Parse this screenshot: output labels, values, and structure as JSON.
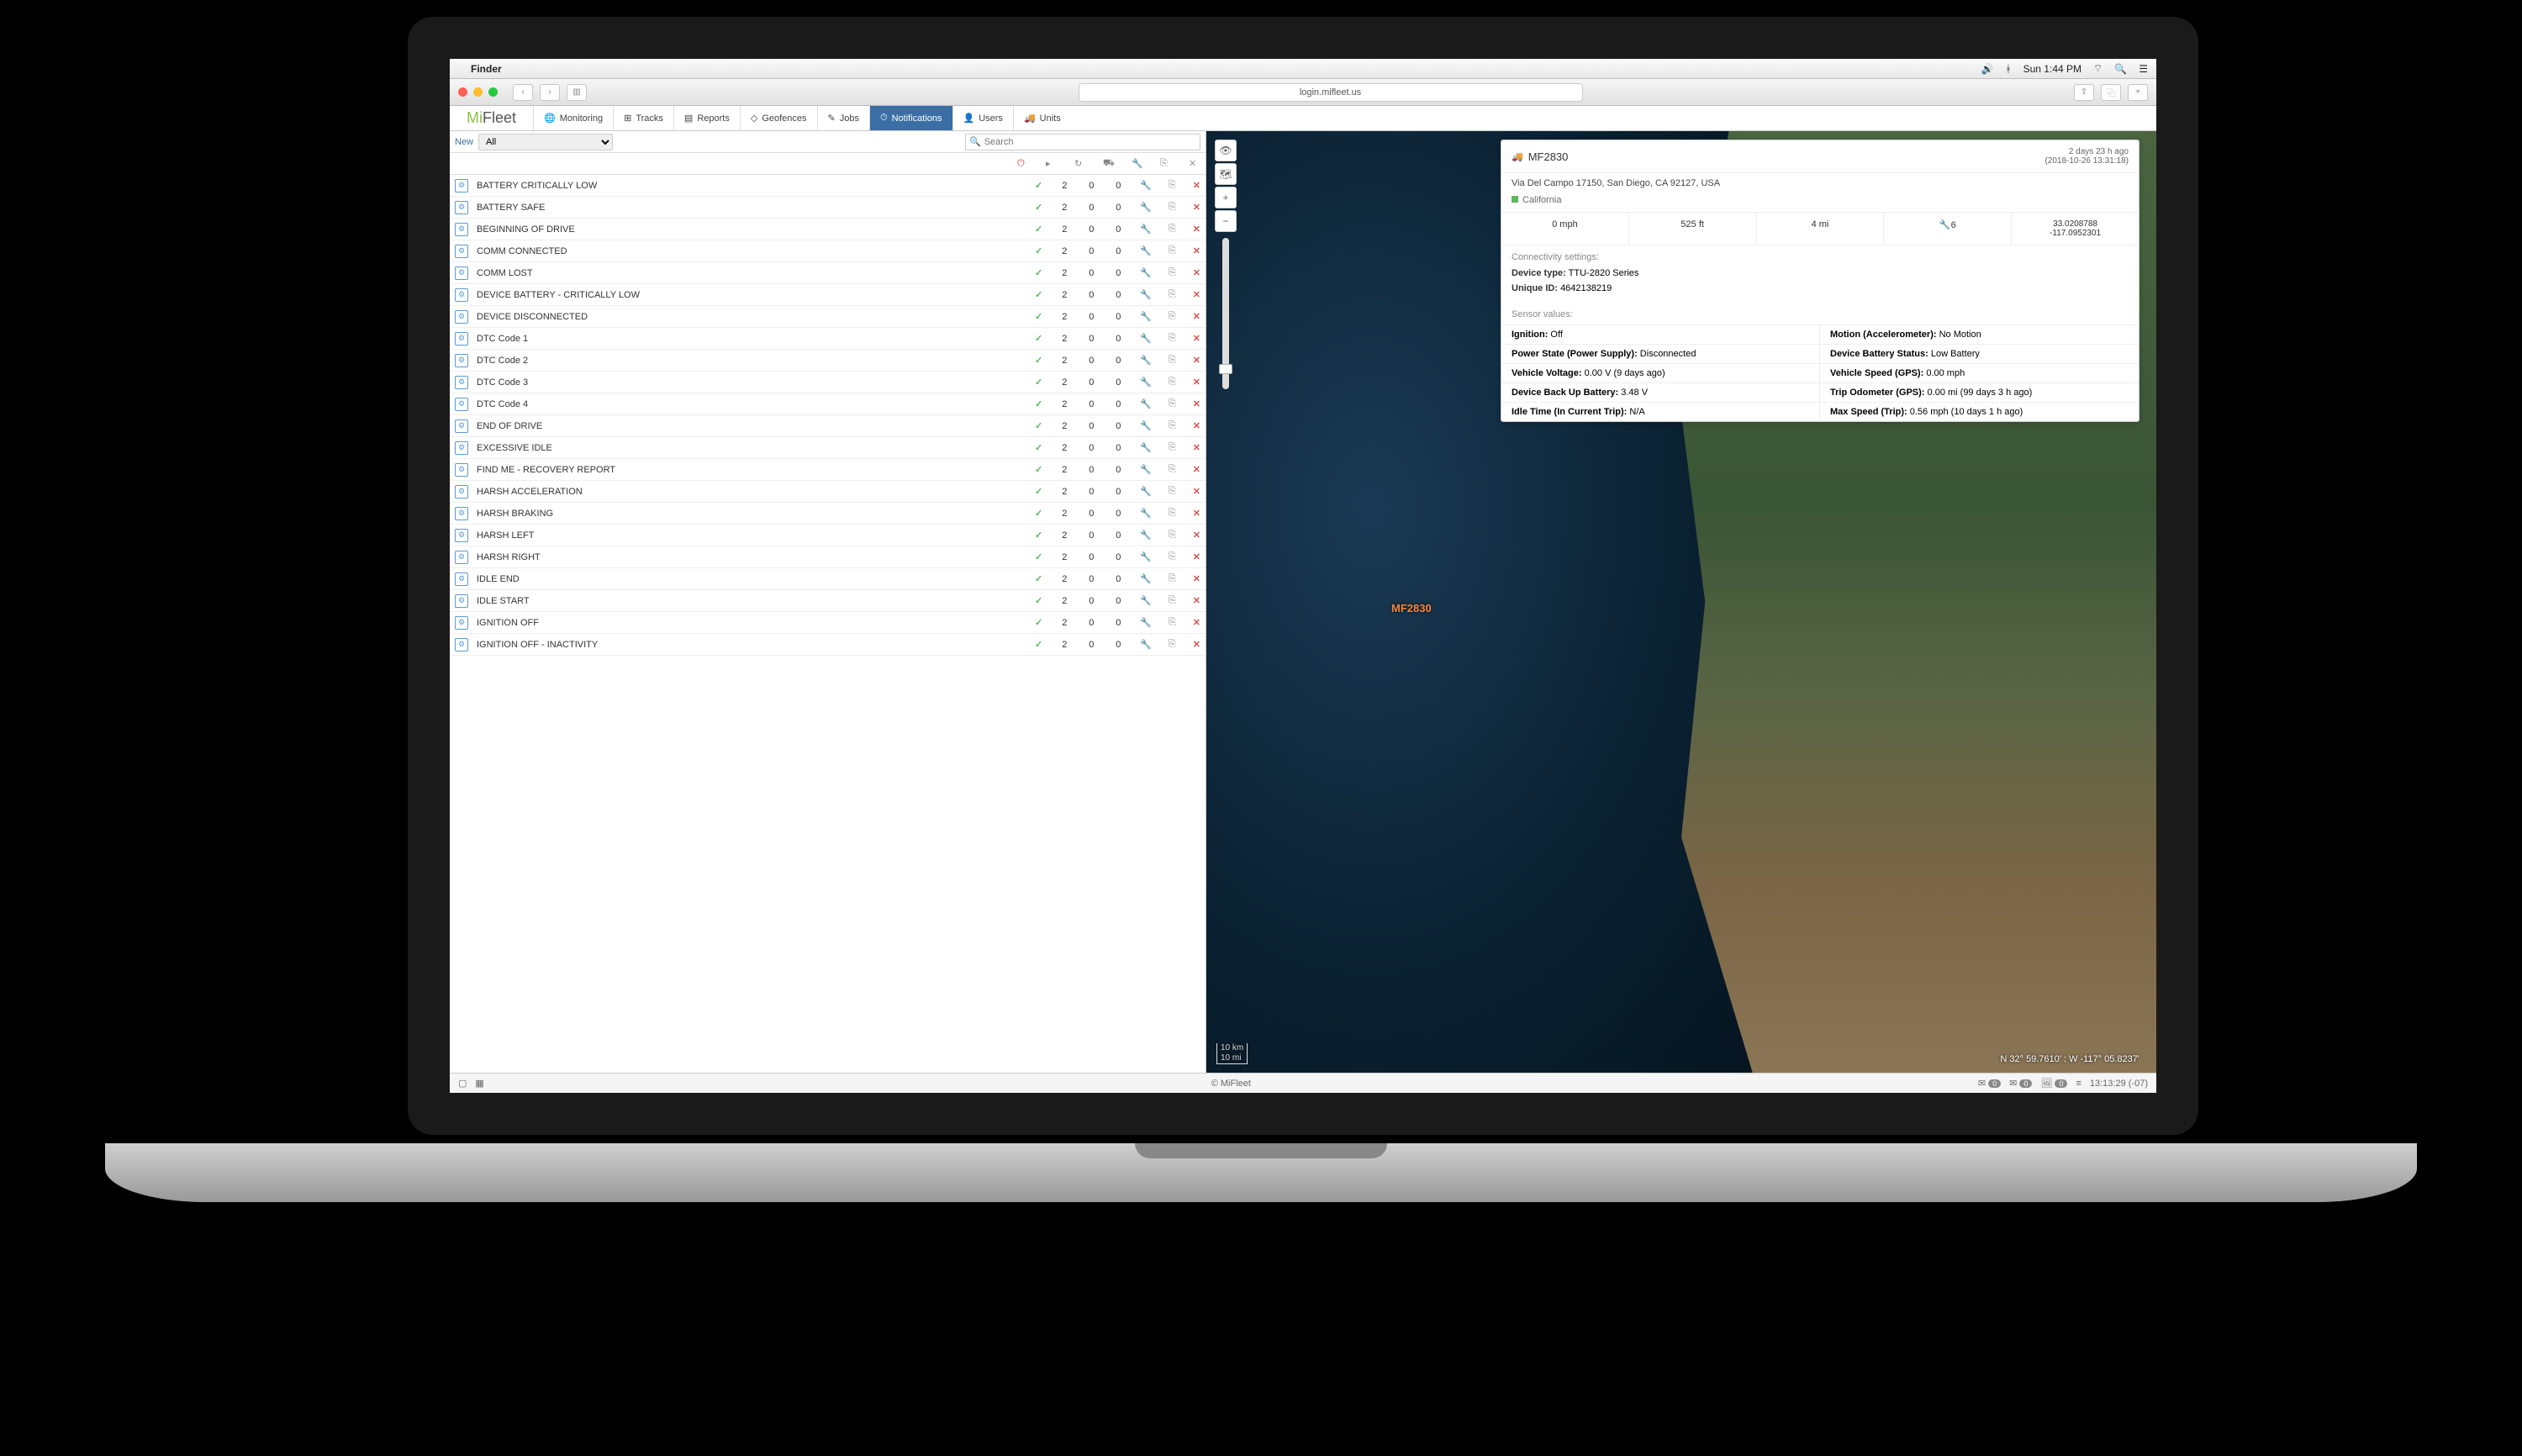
{
  "menubar": {
    "app": "Finder",
    "clock": "Sun 1:44 PM"
  },
  "browser": {
    "url": "login.mifleet.us"
  },
  "logo": {
    "mi": "Mi",
    "fleet": "Fleet"
  },
  "tabs": {
    "monitoring": "Monitoring",
    "tracks": "Tracks",
    "reports": "Reports",
    "geofences": "Geofences",
    "jobs": "Jobs",
    "notifications": "Notifications",
    "users": "Users",
    "units": "Units"
  },
  "filter": {
    "new": "New",
    "all": "All",
    "search_placeholder": "Search"
  },
  "notifications": [
    {
      "name": "BATTERY CRITICALLY LOW",
      "c1": "2",
      "c2": "0",
      "c3": "0"
    },
    {
      "name": "BATTERY SAFE",
      "c1": "2",
      "c2": "0",
      "c3": "0"
    },
    {
      "name": "BEGINNING OF DRIVE",
      "c1": "2",
      "c2": "0",
      "c3": "0"
    },
    {
      "name": "COMM CONNECTED",
      "c1": "2",
      "c2": "0",
      "c3": "0"
    },
    {
      "name": "COMM LOST",
      "c1": "2",
      "c2": "0",
      "c3": "0"
    },
    {
      "name": "DEVICE BATTERY - CRITICALLY LOW",
      "c1": "2",
      "c2": "0",
      "c3": "0"
    },
    {
      "name": "DEVICE DISCONNECTED",
      "c1": "2",
      "c2": "0",
      "c3": "0"
    },
    {
      "name": "DTC Code 1",
      "c1": "2",
      "c2": "0",
      "c3": "0"
    },
    {
      "name": "DTC Code 2",
      "c1": "2",
      "c2": "0",
      "c3": "0"
    },
    {
      "name": "DTC Code 3",
      "c1": "2",
      "c2": "0",
      "c3": "0"
    },
    {
      "name": "DTC Code 4",
      "c1": "2",
      "c2": "0",
      "c3": "0"
    },
    {
      "name": "END OF DRIVE",
      "c1": "2",
      "c2": "0",
      "c3": "0"
    },
    {
      "name": "EXCESSIVE IDLE",
      "c1": "2",
      "c2": "0",
      "c3": "0"
    },
    {
      "name": "FIND ME - RECOVERY REPORT",
      "c1": "2",
      "c2": "0",
      "c3": "0"
    },
    {
      "name": "HARSH ACCELERATION",
      "c1": "2",
      "c2": "0",
      "c3": "0"
    },
    {
      "name": "HARSH BRAKING",
      "c1": "2",
      "c2": "0",
      "c3": "0"
    },
    {
      "name": "HARSH LEFT",
      "c1": "2",
      "c2": "0",
      "c3": "0"
    },
    {
      "name": "HARSH RIGHT",
      "c1": "2",
      "c2": "0",
      "c3": "0"
    },
    {
      "name": "IDLE END",
      "c1": "2",
      "c2": "0",
      "c3": "0"
    },
    {
      "name": "IDLE START",
      "c1": "2",
      "c2": "0",
      "c3": "0"
    },
    {
      "name": "IGNITION OFF",
      "c1": "2",
      "c2": "0",
      "c3": "0"
    },
    {
      "name": "IGNITION OFF - INACTIVITY",
      "c1": "2",
      "c2": "0",
      "c3": "0"
    }
  ],
  "popup": {
    "name": "MF2830",
    "ago": "2 days 23 h ago",
    "timestamp": "(2018-10-26 13:31:18)",
    "address": "Via Del Campo 17150, San Diego, CA 92127, USA",
    "geofence": "California",
    "stats": {
      "speed": "0 mph",
      "altitude": "525 ft",
      "distance": "4 mi",
      "sat": "6",
      "lat": "33.0208788",
      "lon": "-117.0952301"
    },
    "conn": {
      "title": "Connectivity settings:",
      "device_type_l": "Device type:",
      "device_type_v": "TTU-2820 Series",
      "unique_id_l": "Unique ID:",
      "unique_id_v": "4642138219"
    },
    "sensors_title": "Sensor values:",
    "sensors": [
      {
        "l": "Ignition:",
        "v": "Off"
      },
      {
        "l": "Motion (Accelerometer):",
        "v": "No Motion"
      },
      {
        "l": "Power State (Power Supply):",
        "v": "Disconnected"
      },
      {
        "l": "Device Battery Status:",
        "v": "Low Battery"
      },
      {
        "l": "Vehicle Voltage:",
        "v": "0.00 V (9 days ago)"
      },
      {
        "l": "Vehicle Speed (GPS):",
        "v": "0.00 mph"
      },
      {
        "l": "Device Back Up Battery:",
        "v": "3.48 V"
      },
      {
        "l": "Trip Odometer (GPS):",
        "v": "0.00 mi (99 days 3 h ago)"
      },
      {
        "l": "Idle Time (In Current Trip):",
        "v": "N/A"
      },
      {
        "l": "Max Speed (Trip):",
        "v": "0.56 mph (10 days 1 h ago)"
      }
    ]
  },
  "map": {
    "marker_label": "MF2830",
    "coords": "N 32° 59.7610' : W -117° 05.8237'",
    "scale_top": "10 km",
    "scale_bottom": "10 mi"
  },
  "footer": {
    "copyright": "© MiFleet",
    "badge0": "0",
    "time": "13:13:29 (-07)"
  }
}
